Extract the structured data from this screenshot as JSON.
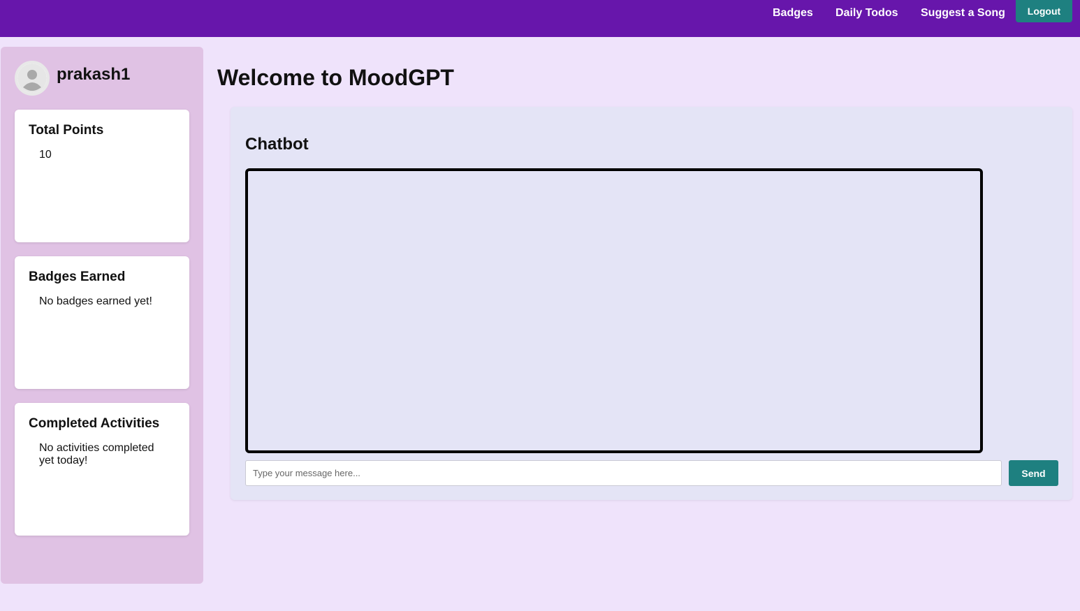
{
  "nav": {
    "links": [
      {
        "label": "Badges"
      },
      {
        "label": "Daily Todos"
      },
      {
        "label": "Suggest a Song"
      }
    ],
    "logout_label": "Logout"
  },
  "sidebar": {
    "username": "prakash1",
    "avatar_icon": "user-avatar-icon",
    "cards": [
      {
        "title": "Total Points",
        "value": "10"
      },
      {
        "title": "Badges Earned",
        "value": "No badges earned yet!"
      },
      {
        "title": "Completed Activities",
        "value": "No activities completed yet today!"
      }
    ]
  },
  "main": {
    "title": "Welcome to MoodGPT",
    "chatbot": {
      "title": "Chatbot",
      "input_placeholder": "Type your message here...",
      "input_value": "",
      "send_label": "Send"
    }
  },
  "colors": {
    "topbar": "#6716ab",
    "background": "#efe3fb",
    "sidebar": "#e0c2e4",
    "accent_button": "#1e8080",
    "chat_panel": "#e4e4f6"
  }
}
